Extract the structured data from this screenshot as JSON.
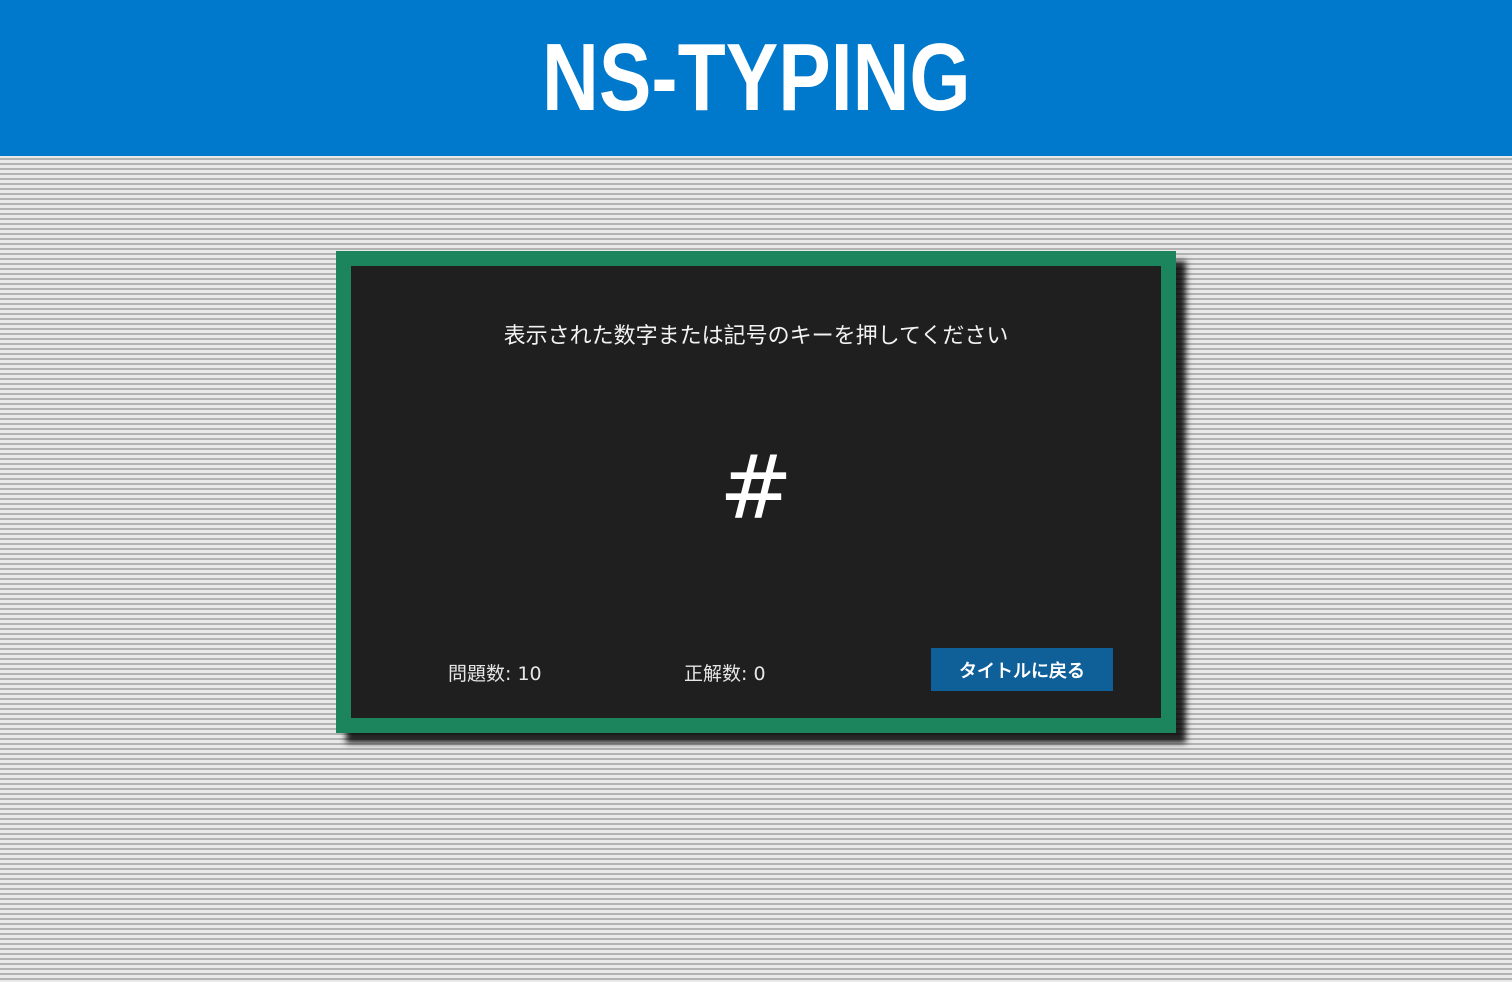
{
  "header": {
    "title": "NS-TYPING"
  },
  "game": {
    "instruction": "表示された数字または記号のキーを押してください",
    "target_char": "#",
    "question_count_label": "問題数: 10",
    "correct_count_label": "正解数: 0",
    "back_button_label": "タイトルに戻る"
  },
  "colors": {
    "header_bg": "#0079cc",
    "panel_border": "#1c855e",
    "panel_bg": "#1f1f1f",
    "button_bg": "#0f5f99"
  }
}
